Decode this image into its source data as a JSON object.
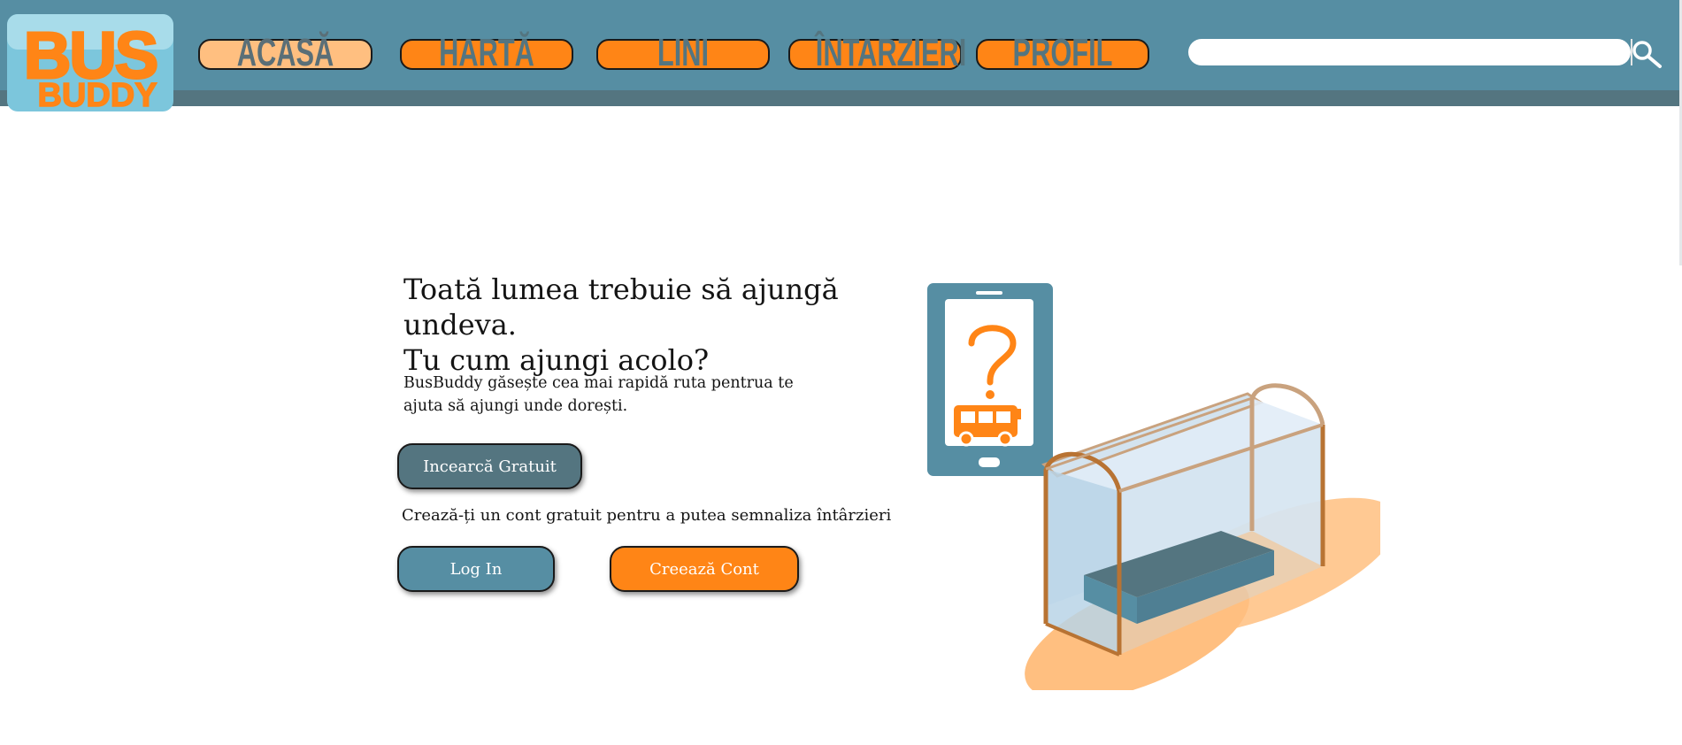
{
  "header": {
    "logo_text": [
      "BUS",
      "BUDDY"
    ],
    "nav": [
      {
        "label": "ACASĂ",
        "active": true
      },
      {
        "label": "HARTĂ",
        "active": false
      },
      {
        "label": "LINI",
        "active": false
      },
      {
        "label": "ÎNTARZIERI",
        "active": false
      },
      {
        "label": "PROFIL",
        "active": false
      }
    ],
    "search": {
      "placeholder": "",
      "value": "",
      "icon": "magnifier-icon"
    }
  },
  "hero": {
    "headline_line1": "Toată lumea trebuie să ajungă undeva.",
    "headline_line2": "Tu cum ajungi acolo?",
    "description_line1": "BusBuddy găsește cea mai rapidă ruta pentrua te",
    "description_line2": "ajuta să ajungi unde dorești.",
    "try_button": "Incearcă Gratuit",
    "signup_hint": "Crează-ți un cont gratuit pentru a putea semnaliza întârzieri",
    "login_button": "Log In",
    "create_account_button": "Creează Cont"
  },
  "illustration": {
    "icons": [
      "phone-icon",
      "question-mark-icon",
      "bus-icon",
      "bus-shelter-icon"
    ]
  },
  "colors": {
    "header_blue": "#568ea3",
    "header_dark": "#547580",
    "orange": "#ff8516",
    "light_orange": "#ffbf80"
  }
}
